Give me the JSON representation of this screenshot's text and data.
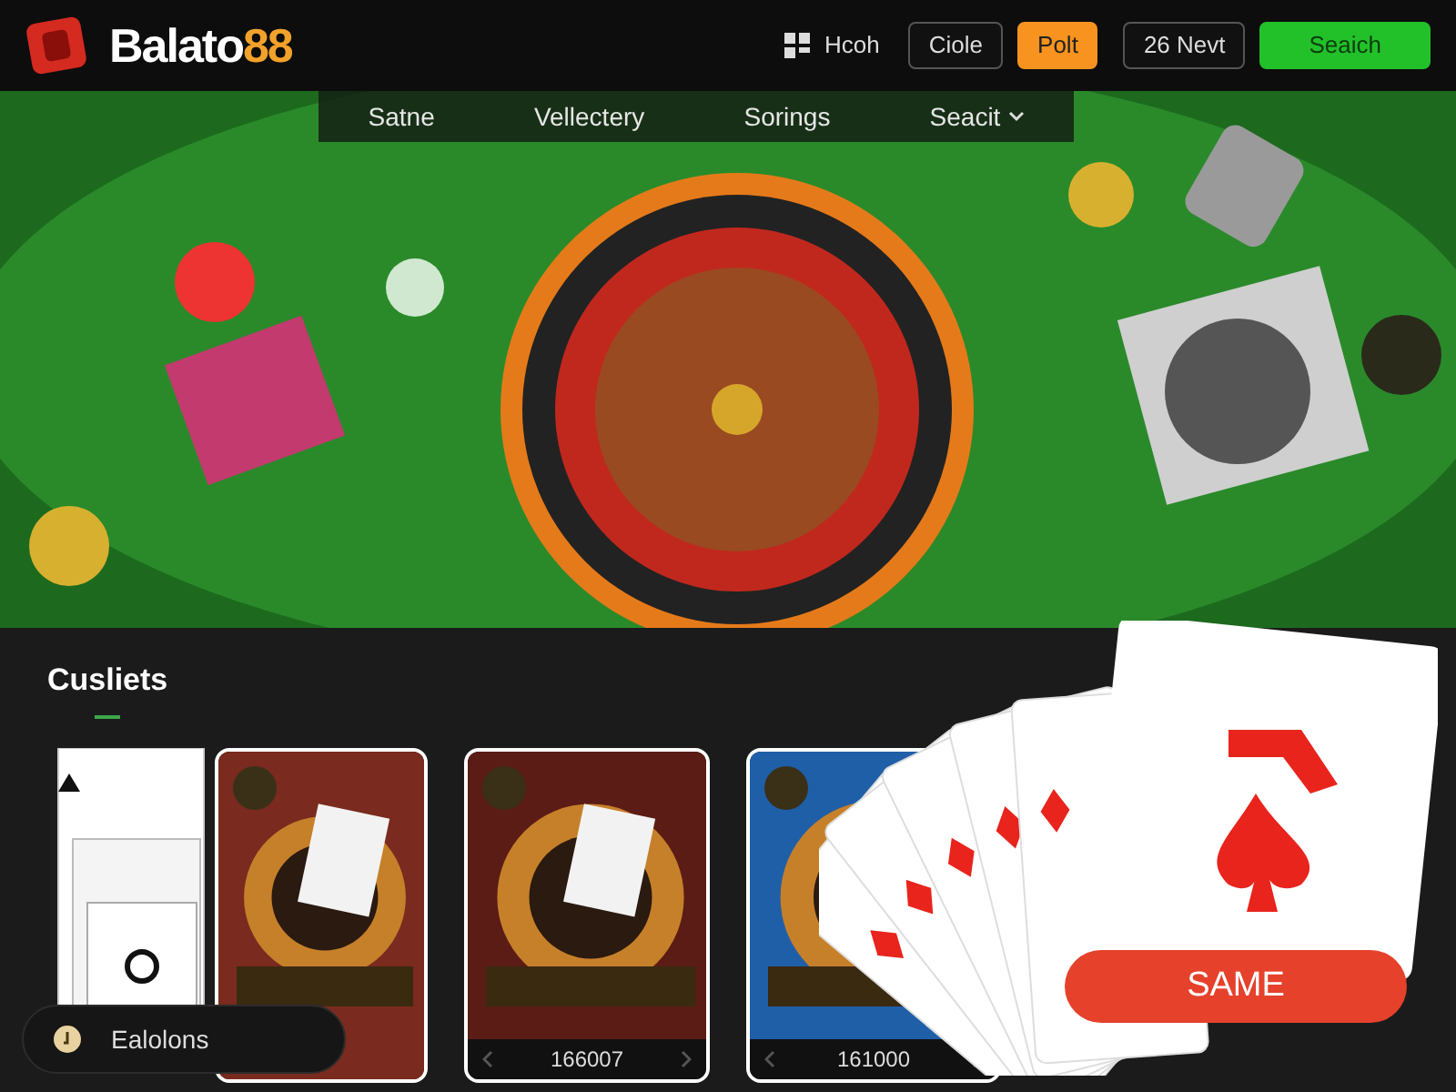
{
  "header": {
    "brand": {
      "name": "Balato",
      "suffix": "88"
    },
    "user": {
      "label": "Hcoh"
    },
    "buttons": [
      {
        "label": "Ciole",
        "kind": "outline"
      },
      {
        "label": "Polt",
        "kind": "orange"
      },
      {
        "label": "26 Nevt",
        "kind": "outline"
      },
      {
        "label": "Seaich",
        "kind": "green"
      }
    ]
  },
  "nav": [
    {
      "label": "Satne",
      "dropdown": false
    },
    {
      "label": "Vellectery",
      "dropdown": false
    },
    {
      "label": "Sorings",
      "dropdown": false
    },
    {
      "label": "Seacit",
      "dropdown": true
    }
  ],
  "section": {
    "title": "Cusliets"
  },
  "games": [
    {
      "kind": "stack"
    },
    {
      "kind": "tile"
    },
    {
      "kind": "tile",
      "count": "166007"
    },
    {
      "kind": "tile",
      "count": "161000"
    }
  ],
  "cta": {
    "label": "SAME"
  },
  "chip": {
    "label": "Ealolons"
  }
}
